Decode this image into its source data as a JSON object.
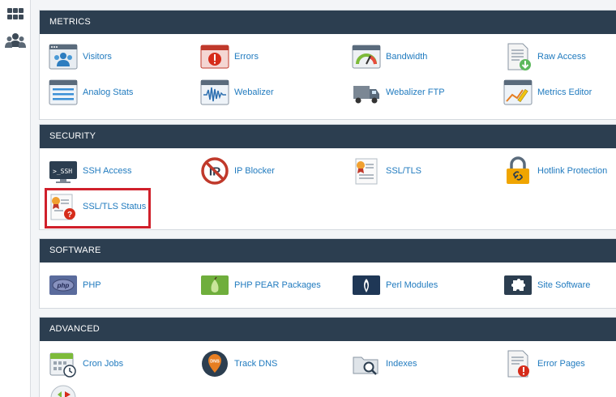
{
  "rail": {
    "items": [
      "apps-grid-icon",
      "users-icon"
    ]
  },
  "colors": {
    "header_bg": "#2c3e50",
    "link": "#217bbf",
    "highlight": "#d0202b"
  },
  "panels": [
    {
      "title": "METRICS",
      "items": [
        {
          "label": "Visitors",
          "icon": "visitors-icon"
        },
        {
          "label": "Errors",
          "icon": "errors-icon"
        },
        {
          "label": "Bandwidth",
          "icon": "bandwidth-icon"
        },
        {
          "label": "Raw Access",
          "icon": "raw-access-icon"
        },
        {
          "label": "Analog Stats",
          "icon": "analog-stats-icon"
        },
        {
          "label": "Webalizer",
          "icon": "webalizer-icon"
        },
        {
          "label": "Webalizer FTP",
          "icon": "webalizer-ftp-icon"
        },
        {
          "label": "Metrics Editor",
          "icon": "metrics-editor-icon"
        }
      ]
    },
    {
      "title": "SECURITY",
      "items": [
        {
          "label": "SSH Access",
          "icon": "ssh-access-icon",
          "icon_text": ">_SSH"
        },
        {
          "label": "IP Blocker",
          "icon": "ip-blocker-icon"
        },
        {
          "label": "SSL/TLS",
          "icon": "ssl-tls-icon"
        },
        {
          "label": "Hotlink Protection",
          "icon": "hotlink-protection-icon"
        },
        {
          "label": "SSL/TLS Status",
          "icon": "ssl-tls-status-icon"
        }
      ]
    },
    {
      "title": "SOFTWARE",
      "items": [
        {
          "label": "PHP",
          "icon": "php-icon"
        },
        {
          "label": "PHP PEAR Packages",
          "icon": "php-pear-packages-icon"
        },
        {
          "label": "Perl Modules",
          "icon": "perl-modules-icon"
        },
        {
          "label": "Site Software",
          "icon": "site-software-icon"
        }
      ]
    },
    {
      "title": "ADVANCED",
      "items": [
        {
          "label": "Cron Jobs",
          "icon": "cron-jobs-icon"
        },
        {
          "label": "Track DNS",
          "icon": "track-dns-icon",
          "icon_text": "DNS"
        },
        {
          "label": "Indexes",
          "icon": "indexes-icon"
        },
        {
          "label": "Error Pages",
          "icon": "error-pages-icon"
        }
      ]
    }
  ]
}
